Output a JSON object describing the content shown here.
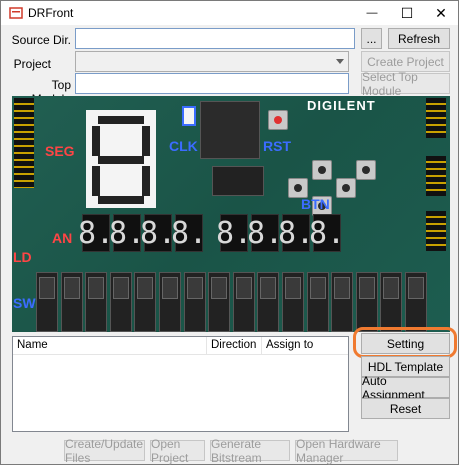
{
  "window": {
    "title": "DRFront",
    "controls": {
      "minimize": "—",
      "maximize": "☐",
      "close": "✕"
    }
  },
  "form": {
    "source_dir": {
      "label": "Source Dir.",
      "value": "",
      "browse_label": "...",
      "refresh_label": "Refresh"
    },
    "project": {
      "label": "Project",
      "value": "",
      "create_label": "Create Project"
    },
    "top_module": {
      "label": "Top Module",
      "value": "",
      "select_label": "Select Top Module"
    }
  },
  "board": {
    "labels": {
      "seg": "SEG",
      "clk": "CLK",
      "rst": "RST",
      "btn": "BTN",
      "an": "AN",
      "ld": "LD",
      "sw": "SW"
    },
    "brand": "DIGILENT",
    "digits": [
      "8.",
      "8.",
      "8.",
      "8.",
      "8.",
      "8.",
      "8.",
      "8."
    ],
    "switch_count": 16
  },
  "table": {
    "columns": [
      "Name",
      "Direction",
      "Assign to"
    ],
    "rows": []
  },
  "side_buttons": {
    "setting": "Setting",
    "hdl_template": "HDL Template",
    "auto_assignment": "Auto Assignment",
    "reset": "Reset"
  },
  "bottom_buttons": {
    "create_update": "Create/Update Files",
    "open_project": "Open Project",
    "generate_bitstream": "Generate Bitstream",
    "open_hw_manager": "Open Hardware Manager"
  },
  "colors": {
    "highlight": "#f07a30",
    "board": "#1d5a4a",
    "seg_label": "#ff4545",
    "clk_label": "#3b6cff"
  }
}
